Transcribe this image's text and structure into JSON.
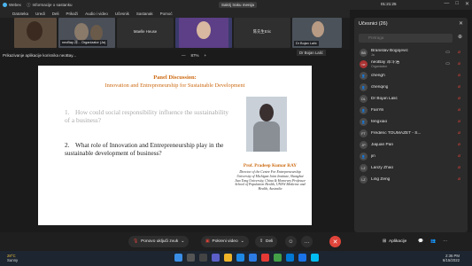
{
  "window": {
    "app_name": "Webex",
    "info_label": "Informacije o sastanku",
    "clock": "Sakrij traku menija",
    "timer": "01:21:25",
    "controls": [
      "—",
      "□",
      "✕"
    ]
  },
  "menu": [
    "Datoteka",
    "Uredi",
    "Deli",
    "Prikaži",
    "Audio i video",
    "Učesnik",
    "Sastanak",
    "Pomoć"
  ],
  "video_tiles": [
    {
      "label": ""
    },
    {
      "label": "neoBay 邓... Organizator (Ja)"
    },
    {
      "label": "Maelle Heuse"
    },
    {
      "label": ""
    },
    {
      "label": "陈先生Eric"
    },
    {
      "label": "Dr Bojan Lalić"
    }
  ],
  "share": {
    "title": "Prikazivanje aplikacije korisnika neoBay...",
    "zoom_out": "—",
    "zoom": "87%",
    "zoom_in": "+",
    "presenter": "Dr Bojan Lalić"
  },
  "slide": {
    "title1": "Panel Discussion:",
    "title2": "Innovation and Entrepreneurship for Sustainable Development",
    "q1_num": "1.",
    "q1": "How could social responsibility influence the sustainability of a business?",
    "q2_num": "2.",
    "q2": "What role of Innovation and Entrepreneurship play in the sustainable development of business?",
    "presenter_name": "Prof. Pradeep Kumar RAY",
    "presenter_desc": "Director of the Centre For Entrepreneurship University of Michigan Joint Institute, Shanghai Jiao Tong University, China & Honorary Professor School of Population Health, UNSW Medicine and Health, Australia"
  },
  "controls": {
    "mute": "Ponovo uključi zvuk",
    "video": "Pokreni video",
    "share": "Deli",
    "apps": "Aplikacije"
  },
  "panel": {
    "title": "Učesnici (26)",
    "search_placeholder": "Pretraga",
    "participants": [
      {
        "initials": "BB",
        "name": "Branislav Bogojević",
        "role": "Ja"
      },
      {
        "initials": "ne",
        "name": "neoBay 邓斗浩",
        "role": "Organizator"
      },
      {
        "initials": "",
        "name": "chengh",
        "role": ""
      },
      {
        "initials": "",
        "name": "chenqing",
        "role": ""
      },
      {
        "initials": "DL",
        "name": "Dr Bojan Lalić",
        "role": ""
      },
      {
        "initials": "",
        "name": "FanYili",
        "role": ""
      },
      {
        "initials": "",
        "name": "fengxiao",
        "role": ""
      },
      {
        "initials": "FT",
        "name": "Frédéric TOUMAZET - S...",
        "role": ""
      },
      {
        "initials": "JP",
        "name": "Jiajuan Pan",
        "role": ""
      },
      {
        "initials": "",
        "name": "jin",
        "role": ""
      },
      {
        "initials": "LZ",
        "name": "Lanzy Zhao",
        "role": ""
      },
      {
        "initials": "LZ",
        "name": "Ling Zeng",
        "role": ""
      }
    ]
  },
  "taskbar": {
    "weather_temp": "28°C",
    "weather_desc": "Sunny",
    "time": "2:36 PM",
    "date": "6/15/2022"
  }
}
